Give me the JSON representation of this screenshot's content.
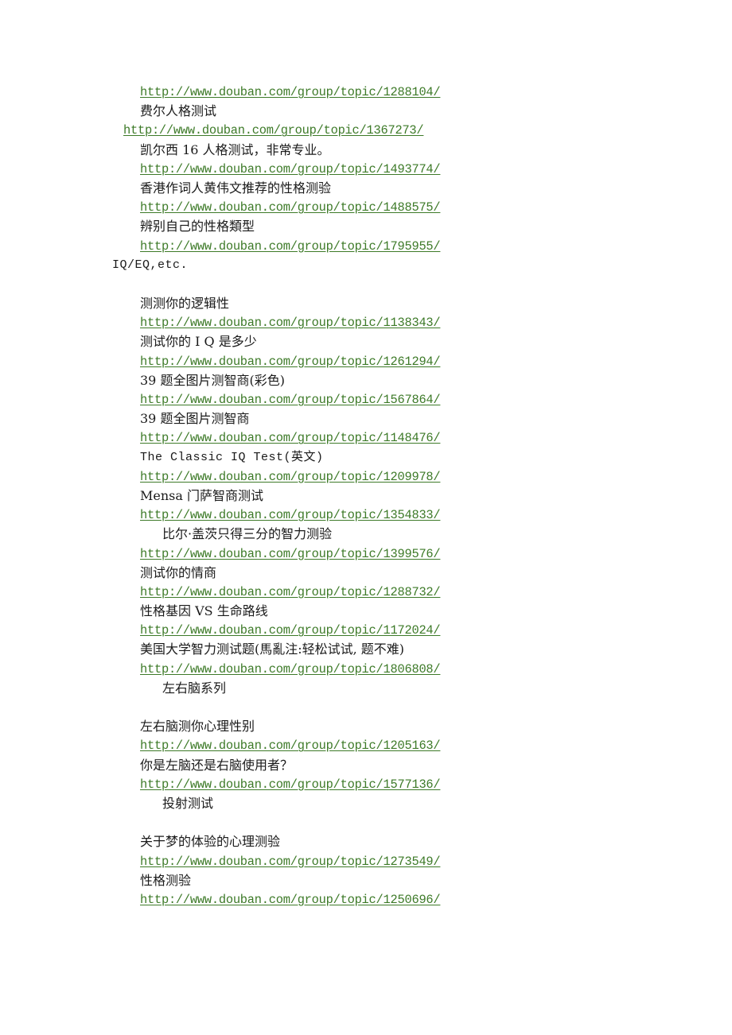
{
  "document": {
    "background_color": "#ffffff",
    "text_color": "#1a1a1a",
    "link_color": "#3d7a28",
    "lines": [
      {
        "text": "http://www.douban.com/group/topic/1288104/",
        "kind": "url",
        "indent": 2
      },
      {
        "text": "费尔人格测试",
        "kind": "cn",
        "indent": 2
      },
      {
        "text": "http://www.douban.com/group/topic/1367273/",
        "kind": "url",
        "indent": 1
      },
      {
        "text": "凯尔西 16 人格测试，非常专业。",
        "kind": "cn",
        "indent": 2
      },
      {
        "text": "http://www.douban.com/group/topic/1493774/",
        "kind": "url",
        "indent": 2
      },
      {
        "text": "香港作词人黄伟文推荐的性格测验",
        "kind": "cn",
        "indent": 2
      },
      {
        "text": "http://www.douban.com/group/topic/1488575/",
        "kind": "url",
        "indent": 2
      },
      {
        "text": "辨别自己的性格類型",
        "kind": "cn",
        "indent": 2
      },
      {
        "text": "http://www.douban.com/group/topic/1795955/",
        "kind": "url",
        "indent": 2
      },
      {
        "text": "IQ/EQ,etc.",
        "kind": "mono",
        "indent": 0
      },
      {
        "text": "",
        "kind": "blank",
        "indent": 0
      },
      {
        "text": "测测你的逻辑性",
        "kind": "cn",
        "indent": 2
      },
      {
        "text": "http://www.douban.com/group/topic/1138343/",
        "kind": "url",
        "indent": 2
      },
      {
        "text": "测试你的 I Q 是多少",
        "kind": "cn",
        "indent": 2
      },
      {
        "text": "http://www.douban.com/group/topic/1261294/",
        "kind": "url",
        "indent": 2
      },
      {
        "text": "39 题全图片测智商(彩色)",
        "kind": "cn",
        "indent": 2
      },
      {
        "text": "http://www.douban.com/group/topic/1567864/",
        "kind": "url",
        "indent": 2
      },
      {
        "text": "39 题全图片测智商",
        "kind": "cn",
        "indent": 2
      },
      {
        "text": "http://www.douban.com/group/topic/1148476/",
        "kind": "url",
        "indent": 2
      },
      {
        "text": "The Classic IQ Test(英文)",
        "kind": "mono",
        "indent": 2
      },
      {
        "text": "http://www.douban.com/group/topic/1209978/",
        "kind": "url",
        "indent": 2
      },
      {
        "text": "Mensa 门萨智商测试",
        "kind": "cn",
        "indent": 2
      },
      {
        "text": "http://www.douban.com/group/topic/1354833/",
        "kind": "url",
        "indent": 2
      },
      {
        "text": "比尔·盖茨只得三分的智力测验",
        "kind": "cn",
        "indent": 3
      },
      {
        "text": "http://www.douban.com/group/topic/1399576/",
        "kind": "url",
        "indent": 2
      },
      {
        "text": "测试你的情商",
        "kind": "cn",
        "indent": 2
      },
      {
        "text": "http://www.douban.com/group/topic/1288732/",
        "kind": "url",
        "indent": 2
      },
      {
        "text": "性格基因 VS 生命路线",
        "kind": "cn",
        "indent": 2
      },
      {
        "text": "http://www.douban.com/group/topic/1172024/",
        "kind": "url",
        "indent": 2
      },
      {
        "text": "美国大学智力测试题(馬亂注:轻松试试, 题不难)",
        "kind": "cn",
        "indent": 2
      },
      {
        "text": "http://www.douban.com/group/topic/1806808/",
        "kind": "url",
        "indent": 2
      },
      {
        "text": "左右脑系列",
        "kind": "cn",
        "indent": 3
      },
      {
        "text": "",
        "kind": "blank",
        "indent": 0
      },
      {
        "text": "左右脑测你心理性别",
        "kind": "cn",
        "indent": 2
      },
      {
        "text": "http://www.douban.com/group/topic/1205163/",
        "kind": "url",
        "indent": 2
      },
      {
        "text": "你是左脑还是右脑使用者？",
        "kind": "cn",
        "indent": 2
      },
      {
        "text": "http://www.douban.com/group/topic/1577136/",
        "kind": "url",
        "indent": 2
      },
      {
        "text": "投射测试",
        "kind": "cn",
        "indent": 3
      },
      {
        "text": "",
        "kind": "blank",
        "indent": 0
      },
      {
        "text": "关于梦的体验的心理测验",
        "kind": "cn",
        "indent": 2
      },
      {
        "text": "http://www.douban.com/group/topic/1273549/",
        "kind": "url",
        "indent": 2
      },
      {
        "text": "性格测验",
        "kind": "cn",
        "indent": 2
      },
      {
        "text": "http://www.douban.com/group/topic/1250696/",
        "kind": "url",
        "indent": 2
      }
    ]
  }
}
